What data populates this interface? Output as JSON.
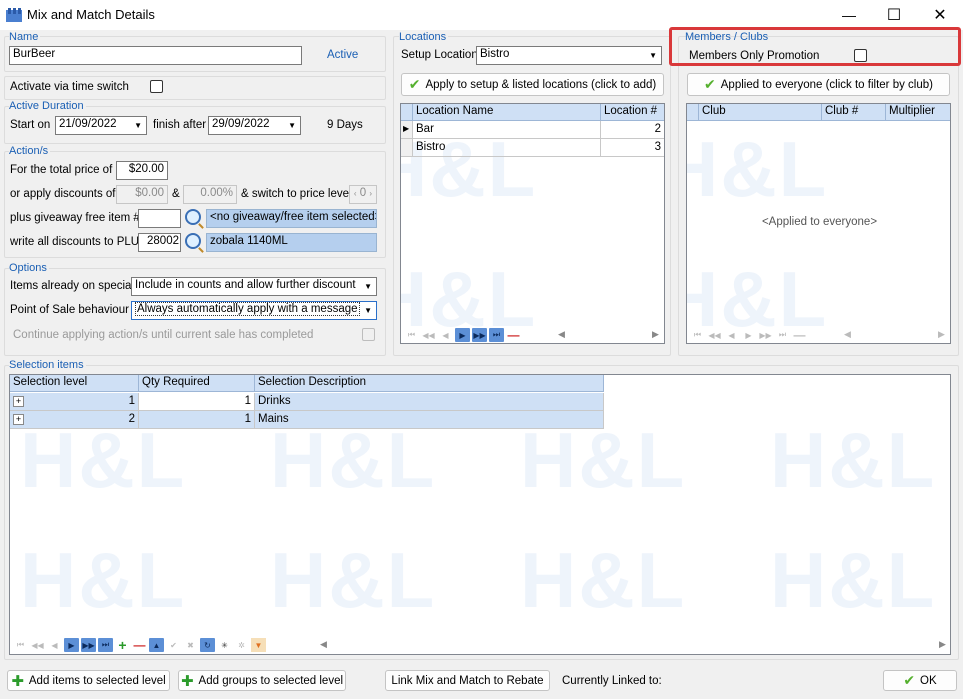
{
  "window": {
    "title": "Mix and Match Details",
    "minimize": "—",
    "maximize": "☐",
    "close": "✕"
  },
  "name_section": {
    "group": "Name",
    "value": "BurBeer",
    "status": "Active"
  },
  "activate": {
    "label": "Activate via time switch"
  },
  "duration": {
    "group": "Active Duration",
    "start_label": "Start on",
    "start": "21/09/2022",
    "finish_label": "finish after",
    "finish": "29/09/2022",
    "days": "9 Days"
  },
  "actions": {
    "group": "Action/s",
    "total_price_label": "For the total price of",
    "total_price": "$20.00",
    "discount_label": "or apply discounts of",
    "discount_amt": "$0.00",
    "amp": "&",
    "discount_pct": "0.00%",
    "switch_label": "& switch to price level",
    "price_level": "0",
    "giveaway_label": "plus giveaway free item #",
    "giveaway_value": "",
    "giveaway_desc": "<no giveaway/free item selected>",
    "plu_label": "write all discounts to PLU",
    "plu": "28002",
    "plu_desc": "zobala 1140ML"
  },
  "options": {
    "group": "Options",
    "special_label": "Items already on special",
    "special_value": "Include in counts and allow further discount",
    "pos_label": "Point of Sale behaviour",
    "pos_value": "Always automatically apply with a message",
    "continue_label": "Continue applying action/s until current sale has completed"
  },
  "locations": {
    "group": "Locations",
    "setup_label": "Setup Location",
    "setup_value": "Bistro",
    "apply_button": "Apply to setup & listed locations (click to add)",
    "columns": [
      "Location Name",
      "Location #"
    ],
    "rows": [
      {
        "name": "Bar",
        "num": "2"
      },
      {
        "name": "Bistro",
        "num": "3"
      }
    ]
  },
  "members": {
    "group": "Members / Clubs",
    "only_label": "Members Only Promotion",
    "apply_button": "Applied to everyone (click to filter by club)",
    "columns": [
      "Club",
      "Club #",
      "Multiplier"
    ],
    "empty": "<Applied to everyone>"
  },
  "selection": {
    "group": "Selection items",
    "columns": [
      "Selection level",
      "Qty Required",
      "Selection Description"
    ],
    "rows": [
      {
        "level": "1",
        "qty": "1",
        "desc": "Drinks"
      },
      {
        "level": "2",
        "qty": "1",
        "desc": "Mains"
      }
    ]
  },
  "footer": {
    "add_items": "Add items to selected level",
    "add_groups": "Add groups to selected level",
    "link_rebate": "Link Mix and Match to Rebate",
    "linked_label": "Currently Linked to:",
    "ok": "OK"
  },
  "watermark": "H&L",
  "colors": {
    "accent": "#1a5fb4",
    "highlight_box": "#d9383a",
    "grid_header": "#cfe0f5"
  }
}
